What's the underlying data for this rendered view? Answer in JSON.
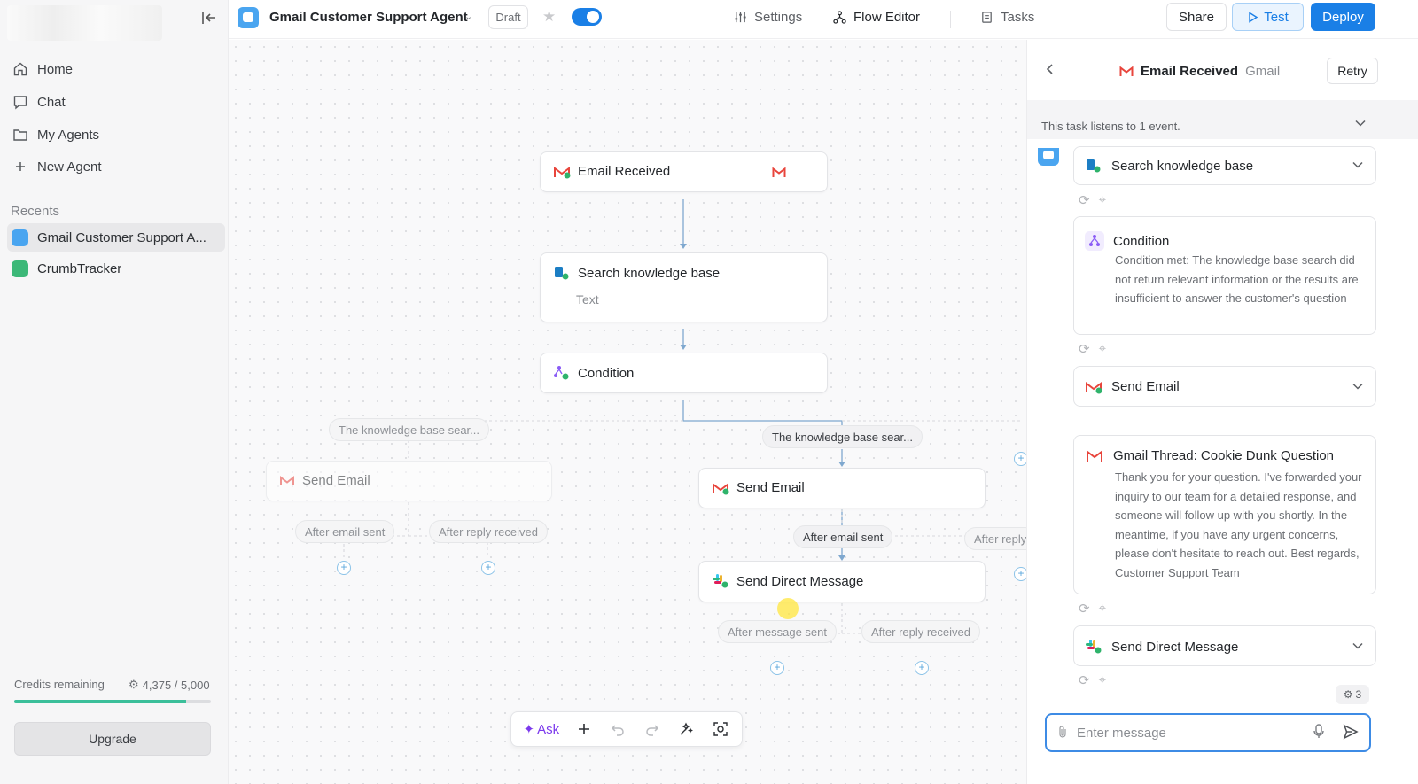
{
  "sidebar": {
    "nav": [
      {
        "label": "Home",
        "icon": "home-icon"
      },
      {
        "label": "Chat",
        "icon": "chat-icon"
      },
      {
        "label": "My Agents",
        "icon": "folder-icon"
      },
      {
        "label": "New Agent",
        "icon": "plus-icon"
      }
    ],
    "recents_label": "Recents",
    "recents": [
      {
        "label": "Gmail Customer Support A...",
        "color": "#4aa5f0"
      },
      {
        "label": "CrumbTracker",
        "color": "#3cb878"
      }
    ],
    "credits_label": "Credits remaining",
    "credits_value": "4,375 / 5,000",
    "credits_fraction": 0.875,
    "upgrade_label": "Upgrade"
  },
  "topbar": {
    "title": "Gmail Customer Support Agent",
    "draft": "Draft",
    "tabs": {
      "settings": "Settings",
      "flow": "Flow Editor",
      "tasks": "Tasks"
    },
    "share": "Share",
    "test": "Test",
    "deploy": "Deploy",
    "accent": "#1a7fe6"
  },
  "canvas": {
    "nodes": {
      "email_received": "Email Received",
      "search_kb": "Search knowledge base",
      "search_kb_sub": "Text",
      "condition": "Condition",
      "send_email_left": "Send Email",
      "send_email_right": "Send Email",
      "send_dm": "Send Direct Message"
    },
    "pills": {
      "branch_left": "The knowledge base sear...",
      "branch_right": "The knowledge base sear...",
      "left_after_email": "After email sent",
      "left_after_reply": "After reply received",
      "right_after_email": "After email sent",
      "right_after_reply": "After reply",
      "after_message": "After message sent",
      "after_reply_dm": "After reply received"
    },
    "toolbar": {
      "ask": "Ask"
    }
  },
  "panel": {
    "title": "Email Received",
    "subtitle": "Gmail",
    "retry": "Retry",
    "listen_text": "This task listens to 1 event.",
    "cards": {
      "search": "Search knowledge base",
      "condition_title": "Condition",
      "condition_text": "Condition met: The knowledge base search did not return relevant information or the results are insufficient to answer the customer's question",
      "send_email": "Send Email",
      "thread_title": "Gmail Thread: Cookie Dunk Question",
      "thread_text": "Thank you for your question. I've forwarded your inquiry to our team for a detailed response, and someone will follow up with you shortly. In the meantime, if you have any urgent concerns, please don't hesitate to reach out. Best regards, Customer Support Team",
      "send_dm": "Send Direct Message"
    },
    "count": "3",
    "composer_placeholder": "Enter message"
  }
}
